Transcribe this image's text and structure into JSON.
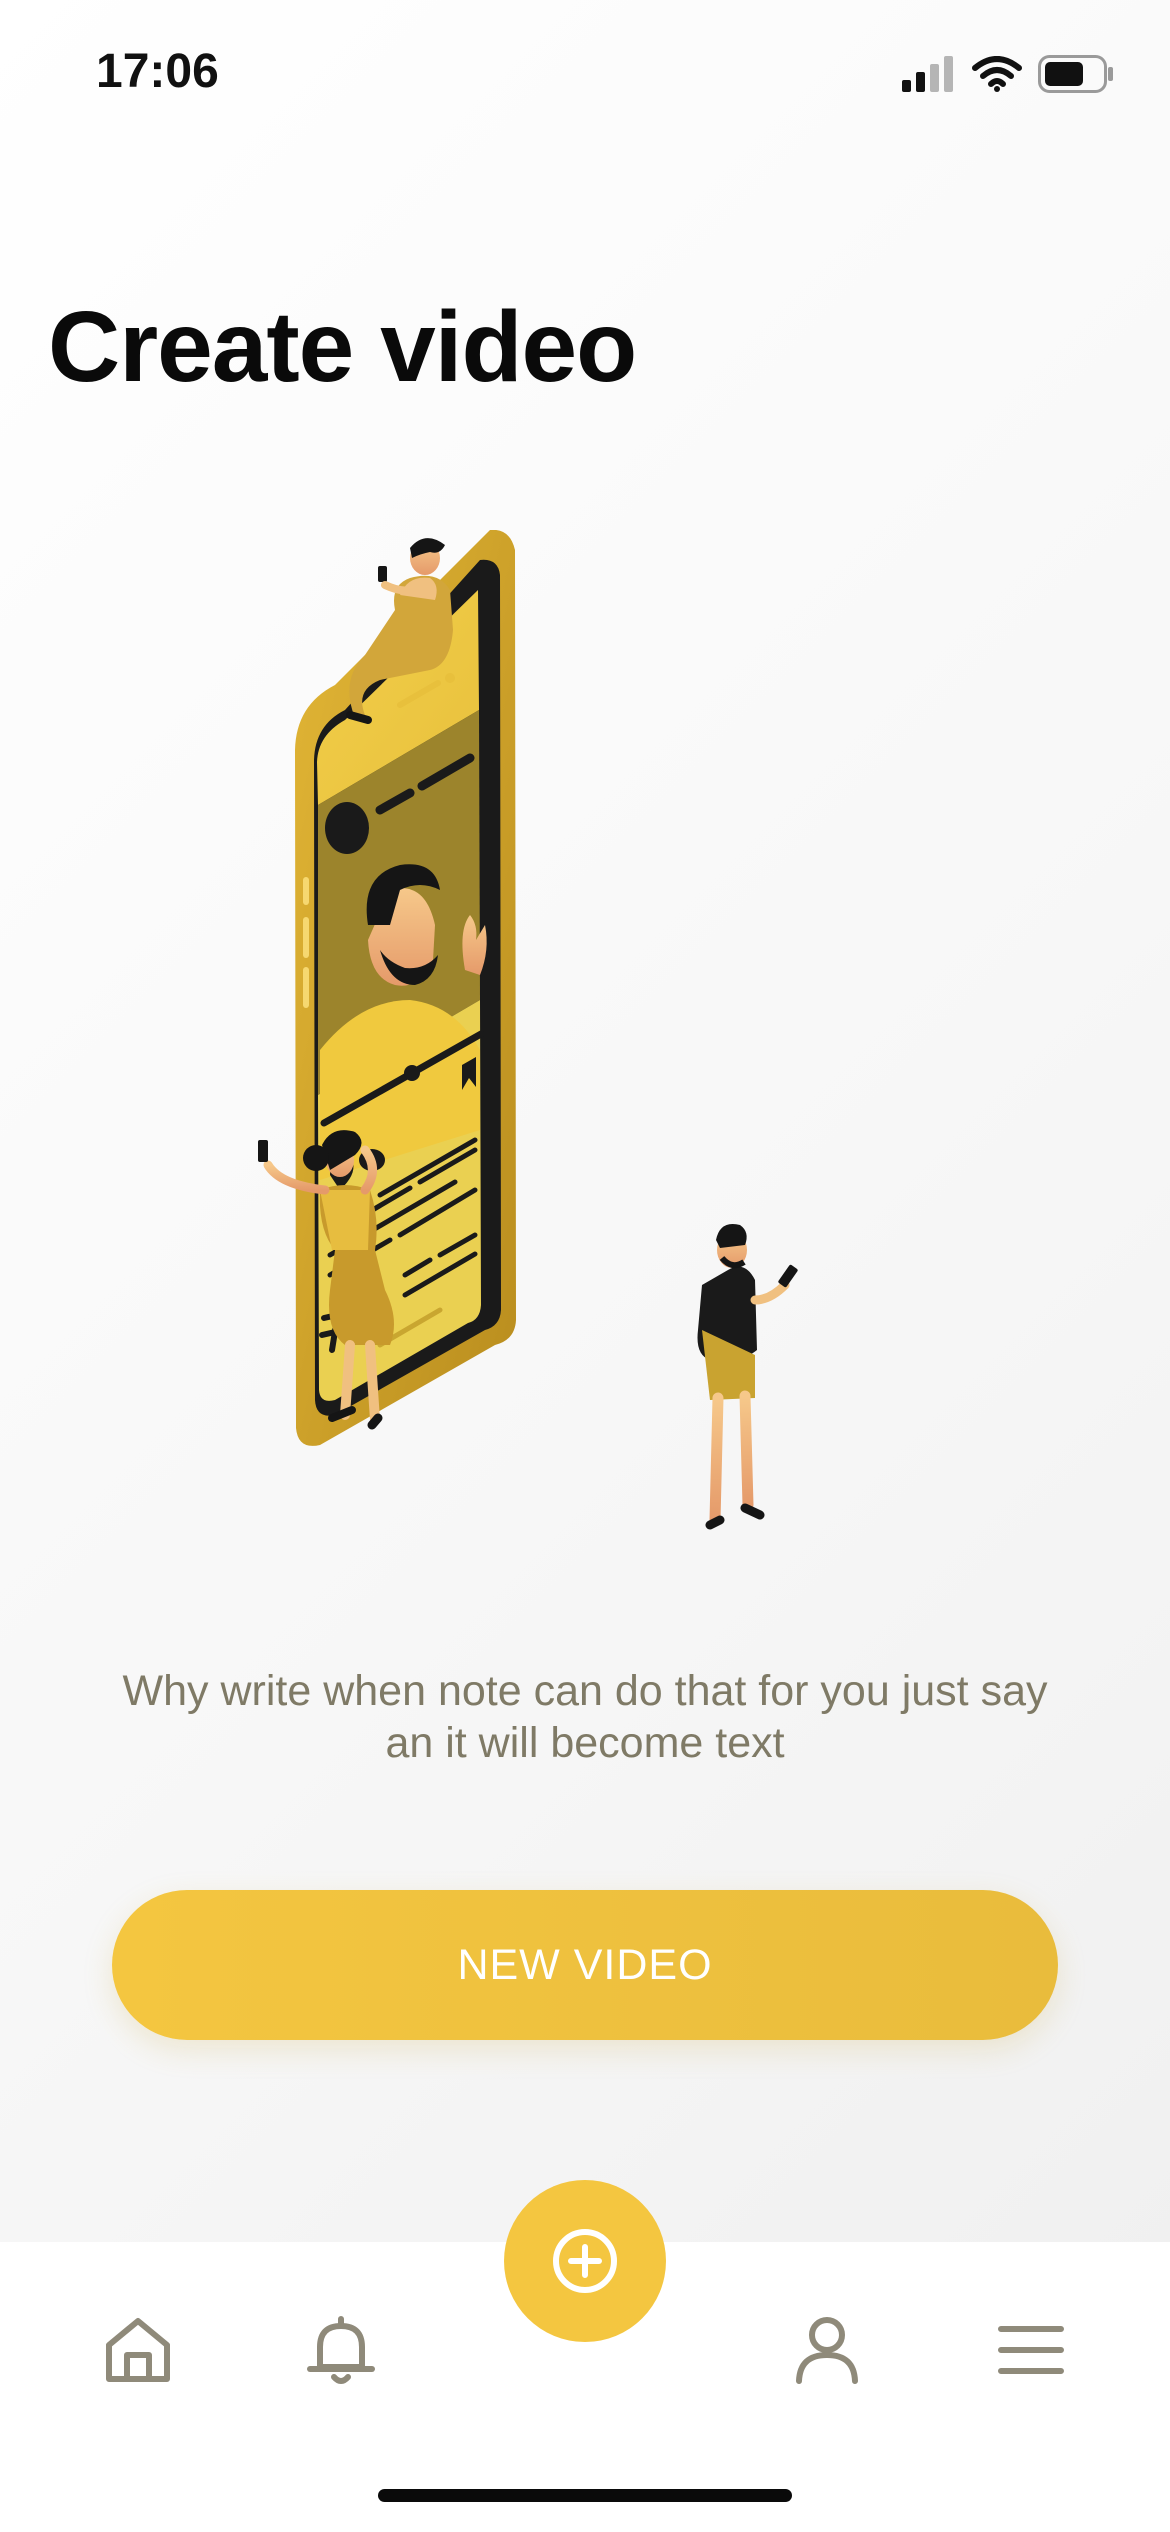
{
  "status_bar": {
    "time": "17:06",
    "icons": [
      "signal-icon",
      "wifi-icon",
      "battery-icon"
    ]
  },
  "page": {
    "title": "Create video",
    "subtitle_line1": "Why write when note can do that for you just say",
    "subtitle_line2": "an it will become text"
  },
  "actions": {
    "new_video_label": "NEW VIDEO"
  },
  "tab_bar": {
    "items": [
      {
        "icon": "home-icon"
      },
      {
        "icon": "bell-icon"
      },
      {
        "icon": "plus-circle-icon"
      },
      {
        "icon": "user-icon"
      },
      {
        "icon": "menu-icon"
      }
    ]
  },
  "colors": {
    "accent": "#f4c640",
    "subtitle": "#7f7a66",
    "icon_gray": "#8f8a7a",
    "text_dark": "#0a0a0a"
  }
}
